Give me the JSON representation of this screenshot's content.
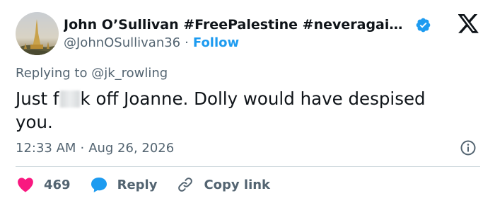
{
  "tweet": {
    "author": {
      "display_name": "John O’Sullivan #FreePalestine #neveragainis…",
      "handle": "@JohnOSullivan36",
      "separator": "·",
      "follow_label": "Follow",
      "verified": true
    },
    "replying_to": "Replying to @jk_rowling",
    "text_before_censor": "Just f",
    "text_after_censor": "k off Joanne. Dolly would have despised you.",
    "time": "12:33 AM",
    "date_separator": "·",
    "date": "Aug 26, 2026",
    "actions": {
      "like_count": "469",
      "reply_label": "Reply",
      "copy_label": "Copy link"
    }
  },
  "colors": {
    "accent": "#1d9bf0",
    "like": "#f91880",
    "text_primary": "#0f1419",
    "text_secondary": "#536471",
    "divider": "#cfd9de"
  },
  "icons": [
    "verified-badge-icon",
    "x-logo-icon",
    "info-icon",
    "heart-icon",
    "speech-bubble-icon",
    "link-icon"
  ]
}
